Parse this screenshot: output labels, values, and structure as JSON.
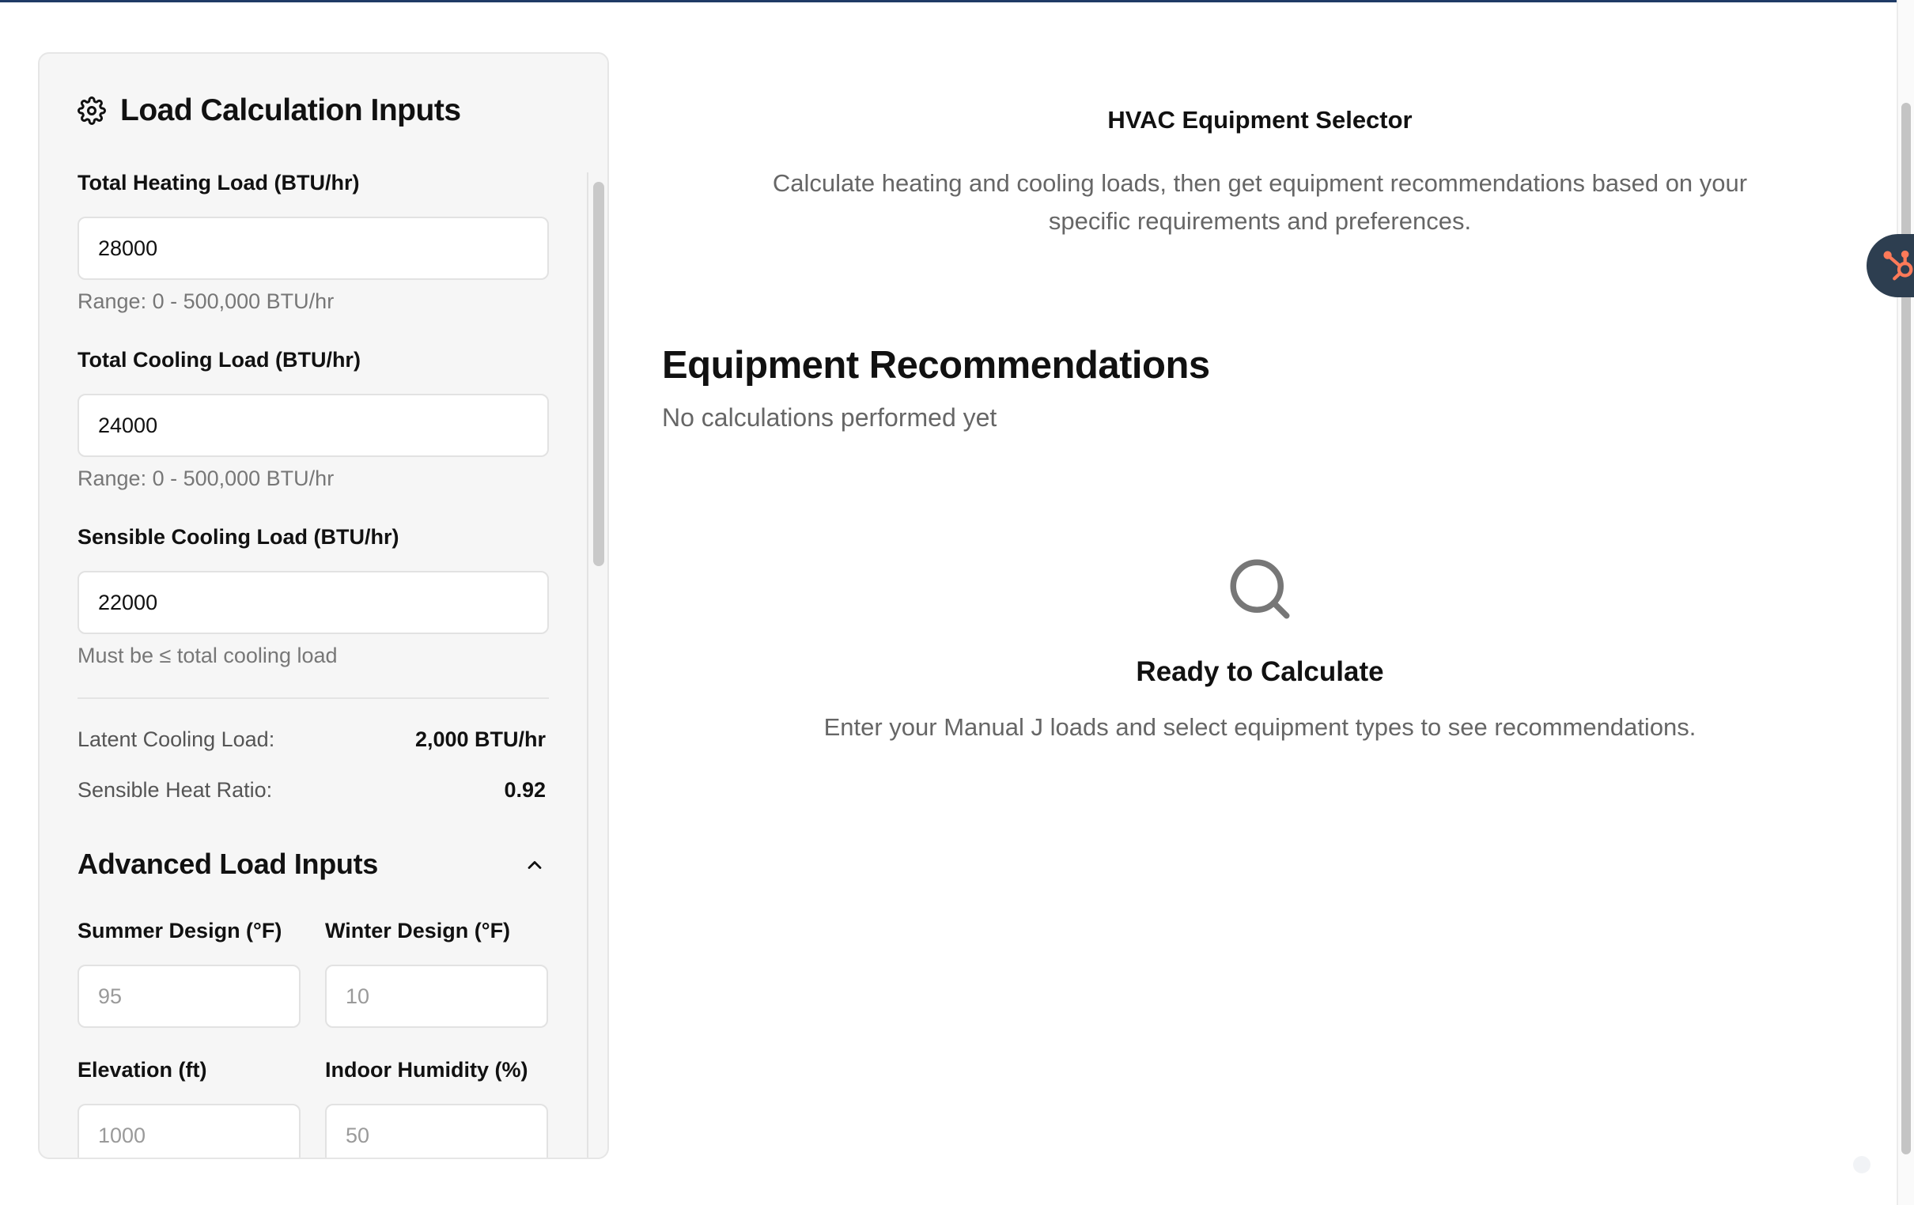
{
  "panel": {
    "title": "Load Calculation Inputs",
    "fields": {
      "heating": {
        "label": "Total Heating Load (BTU/hr)",
        "value": "28000",
        "hint": "Range: 0 - 500,000 BTU/hr"
      },
      "cooling": {
        "label": "Total Cooling Load (BTU/hr)",
        "value": "24000",
        "hint": "Range: 0 - 500,000 BTU/hr"
      },
      "sensible": {
        "label": "Sensible Cooling Load (BTU/hr)",
        "value": "22000",
        "hint": "Must be ≤ total cooling load"
      }
    },
    "stats": {
      "latent_label": "Latent Cooling Load:",
      "latent_value": "2,000 BTU/hr",
      "shr_label": "Sensible Heat Ratio:",
      "shr_value": "0.92"
    },
    "advanced": {
      "title": "Advanced Load Inputs",
      "summer_label": "Summer Design (°F)",
      "summer_placeholder": "95",
      "winter_label": "Winter Design (°F)",
      "winter_placeholder": "10",
      "elevation_label": "Elevation (ft)",
      "elevation_placeholder": "1000",
      "humidity_label": "Indoor Humidity (%)",
      "humidity_placeholder": "50"
    }
  },
  "main": {
    "app_title": "HVAC Equipment Selector",
    "app_description": "Calculate heating and cooling loads, then get equipment recommendations based on your specific requirements and preferences.",
    "recommendations_title": "Equipment Recommendations",
    "recommendations_status": "No calculations performed yet",
    "empty_state": {
      "icon": "search-icon",
      "title": "Ready to Calculate",
      "description": "Enter your Manual J loads and select equipment types to see recommendations."
    }
  },
  "colors": {
    "accent_top_line": "#1f3b66",
    "hubspot_tab": "#2d3e50",
    "hubspot_orange": "#ff7a59"
  }
}
